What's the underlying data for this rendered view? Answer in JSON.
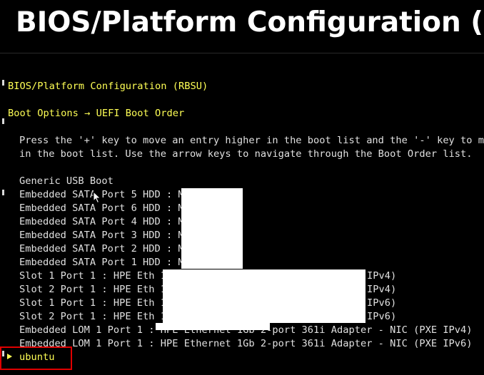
{
  "banner": {
    "title": "BIOS/Platform Configuration (RBS"
  },
  "header": {
    "title": "BIOS/Platform Configuration (RBSU)",
    "breadcrumb": "Boot Options → UEFI Boot Order"
  },
  "instructions": {
    "line1": "Press the '+' key to move an entry higher in the boot list and the '-' key to move",
    "line2": "in the boot list. Use the arrow keys to navigate through the Boot Order list."
  },
  "boot_order": [
    "Generic USB Boot",
    "Embedded SATA Port 5 HDD : MM",
    "Embedded SATA Port 6 HDD : MM",
    "Embedded SATA Port 4 HDD : MM",
    "Embedded SATA Port 3 HDD : MM",
    "Embedded SATA Port 2 HDD : MM",
    "Embedded SATA Port 1 HDD : MM",
    "Slot 1 Port 1 : HPE Eth 1",
    "Slot 2 Port 1 : HPE Eth 1",
    "Slot 1 Port 1 : HPE Eth 1",
    "Slot 2 Port 1 : HPE Eth 1",
    "Embedded LOM 1 Port 1 : HPE Ethernet 1Gb 2-port 361i Adapter - NIC (PXE IPv4)",
    "Embedded LOM 1 Port 1 : HPE Ethernet 1Gb 2-port 361i Adapter - NIC (PXE IPv6)",
    "ubuntu"
  ],
  "boot_order_suffix": [
    "IPv4)",
    "IPv4)",
    "IPv6)",
    "IPv6)"
  ],
  "colors": {
    "accent_yellow": "#ffff55",
    "highlight_red": "#e00000",
    "background": "#000000"
  }
}
